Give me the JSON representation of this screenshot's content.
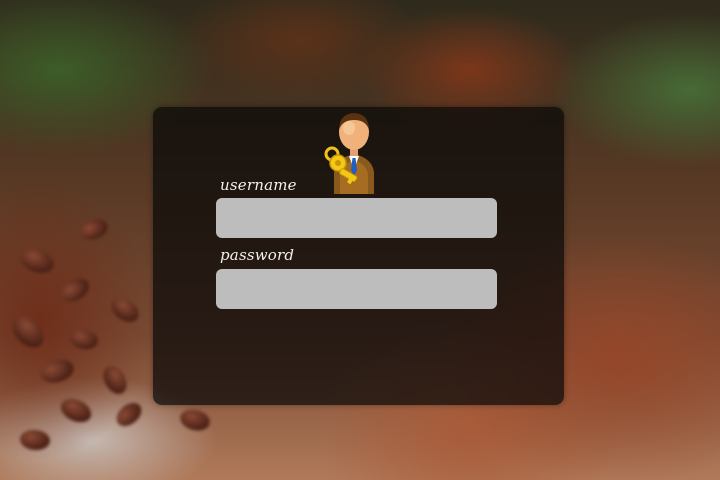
{
  "login": {
    "username_label": "username",
    "password_label": "password",
    "username_value": "",
    "password_value": ""
  },
  "icons": {
    "avatar": "user-with-key-icon"
  },
  "colors": {
    "panel": "#080808",
    "field": "#bdbdbd",
    "label": "#f4f1ea"
  }
}
